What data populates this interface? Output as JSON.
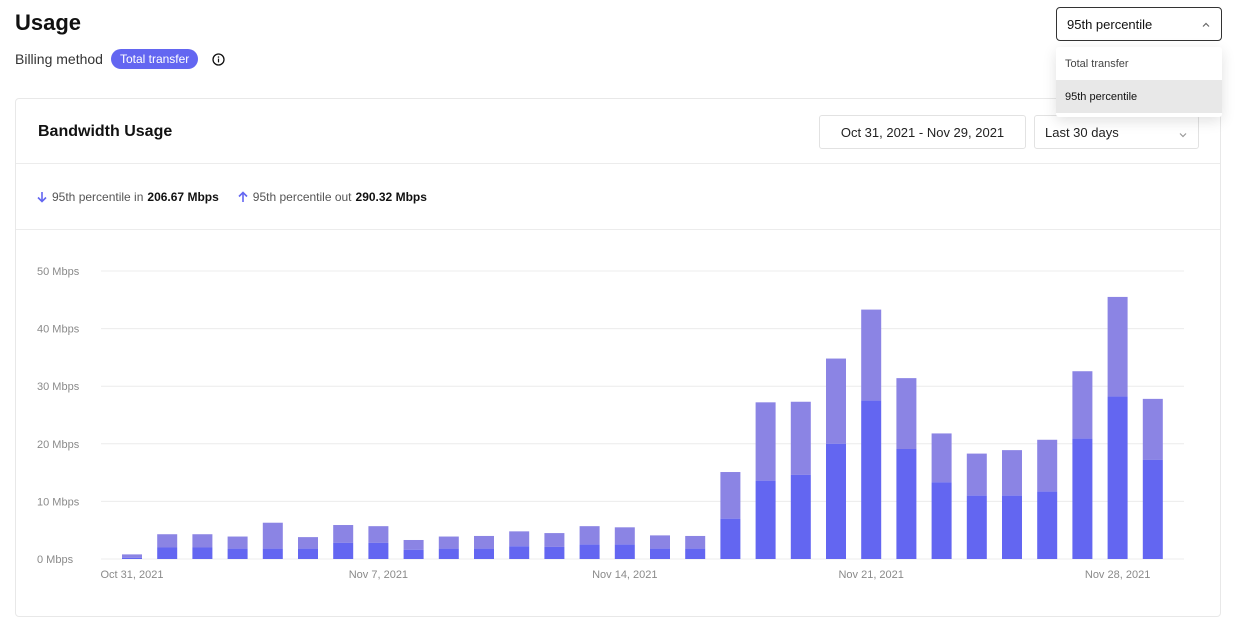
{
  "page": {
    "title": "Usage",
    "billing_label": "Billing method",
    "billing_badge": "Total transfer"
  },
  "billing_select": {
    "value": "95th percentile",
    "options": [
      "Total transfer",
      "95th percentile"
    ],
    "selected_index": 1
  },
  "card": {
    "title": "Bandwidth Usage",
    "date_range": "Oct 31, 2021 - Nov 29, 2021",
    "period": "Last 30 days"
  },
  "stats": {
    "in_label": "95th percentile in",
    "in_value": "206.67 Mbps",
    "out_label": "95th percentile out",
    "out_value": "290.32 Mbps"
  },
  "colors": {
    "accent": "#6366f1",
    "in_color": "#6366f1",
    "out_color": "#8b84e4",
    "gridline": "#ececec"
  },
  "icons": {
    "info": "info-circle-icon",
    "in_arrow": "arrow-down-icon",
    "out_arrow": "arrow-up-icon",
    "chevron": "chevron-icon"
  },
  "chart_data": {
    "type": "bar",
    "stacked": true,
    "ylim": [
      0,
      50
    ],
    "yticks": [
      0,
      10,
      20,
      30,
      40,
      50
    ],
    "ytick_labels": [
      "0 Mbps",
      "10 Mbps",
      "20 Mbps",
      "30 Mbps",
      "40 Mbps",
      "50 Mbps"
    ],
    "xtick_labels": [
      "Oct 31, 2021",
      "Nov 7, 2021",
      "Nov 14, 2021",
      "Nov 21, 2021",
      "Nov 28, 2021"
    ],
    "xtick_positions": [
      0,
      7,
      14,
      21,
      28
    ],
    "categories": [
      "Oct 31",
      "Nov 1",
      "Nov 2",
      "Nov 3",
      "Nov 4",
      "Nov 5",
      "Nov 6",
      "Nov 7",
      "Nov 8",
      "Nov 9",
      "Nov 10",
      "Nov 11",
      "Nov 12",
      "Nov 13",
      "Nov 14",
      "Nov 15",
      "Nov 16",
      "Nov 17",
      "Nov 18",
      "Nov 19",
      "Nov 20",
      "Nov 21",
      "Nov 22",
      "Nov 23",
      "Nov 24",
      "Nov 25",
      "Nov 26",
      "Nov 27",
      "Nov 28",
      "Nov 29"
    ],
    "series": [
      {
        "values": [
          0.2,
          2.0,
          2.0,
          1.8,
          1.8,
          1.8,
          2.8,
          2.8,
          1.6,
          1.8,
          1.8,
          2.2,
          2.1,
          2.5,
          2.5,
          1.8,
          1.8,
          7.0,
          13.6,
          14.6,
          20.0,
          27.5,
          19.1,
          13.3,
          11.0,
          11.0,
          11.7,
          20.9,
          28.2,
          17.2
        ]
      },
      {
        "values": [
          0.6,
          2.3,
          2.3,
          2.1,
          4.5,
          2.0,
          3.1,
          2.9,
          1.7,
          2.1,
          2.2,
          2.6,
          2.4,
          3.2,
          3.0,
          2.3,
          2.2,
          8.1,
          13.6,
          12.7,
          14.8,
          15.8,
          12.3,
          8.5,
          7.3,
          7.9,
          9.0,
          11.7,
          17.3,
          10.6
        ]
      }
    ]
  }
}
